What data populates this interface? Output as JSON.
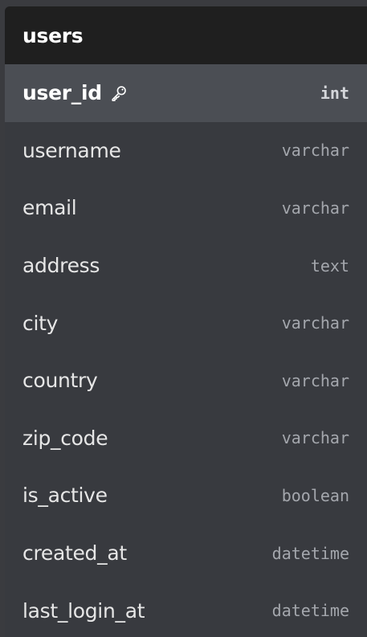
{
  "table": {
    "name": "users",
    "columns": [
      {
        "name": "user_id",
        "type": "int",
        "primary_key": true,
        "icon": "key-icon"
      },
      {
        "name": "username",
        "type": "varchar",
        "primary_key": false
      },
      {
        "name": "email",
        "type": "varchar",
        "primary_key": false
      },
      {
        "name": "address",
        "type": "text",
        "primary_key": false
      },
      {
        "name": "city",
        "type": "varchar",
        "primary_key": false
      },
      {
        "name": "country",
        "type": "varchar",
        "primary_key": false
      },
      {
        "name": "zip_code",
        "type": "varchar",
        "primary_key": false
      },
      {
        "name": "is_active",
        "type": "boolean",
        "primary_key": false
      },
      {
        "name": "created_at",
        "type": "datetime",
        "primary_key": false
      },
      {
        "name": "last_login_at",
        "type": "datetime",
        "primary_key": false
      }
    ]
  },
  "colors": {
    "header_bg": "#1f1f1f",
    "body_bg": "#383a3f",
    "pk_row_bg": "#4b4e54",
    "name_text": "#e6e6e6",
    "type_text": "#a4a7ad"
  }
}
